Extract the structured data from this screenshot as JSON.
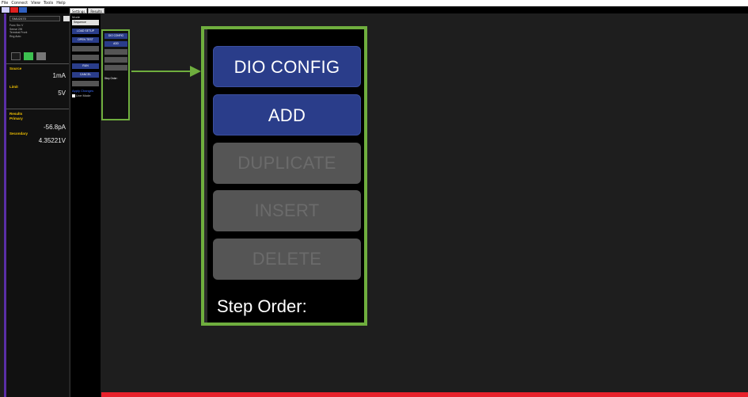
{
  "menu": [
    "File",
    "Connect",
    "View",
    "Tools",
    "Help"
  ],
  "tabs": [
    {
      "label": "Settings",
      "active": true
    },
    {
      "label": "Results",
      "active": false
    }
  ],
  "channel": {
    "name": "SMU2470",
    "info": [
      "Func      Src V",
      "Sense      2W",
      "Terminal   Front",
      "Rng        Auto"
    ],
    "source_label": "Source",
    "source_value": "1mA",
    "limit_label": "Limit",
    "limit_value": "5V",
    "results_label": "Results",
    "primary_label": "Primary",
    "primary_value": "-56.8pA",
    "secondary_label": "Secondary",
    "secondary_value": "4.35221V"
  },
  "mode_column": {
    "label": "Mode",
    "select_value": "Sequence",
    "buttons": [
      {
        "label": "LOAD SETUP",
        "state": "active"
      },
      {
        "label": "OPEN TEST",
        "state": "active"
      },
      {
        "label": "",
        "state": "disabled"
      },
      {
        "label": "",
        "state": "disabled"
      },
      {
        "label": "RUN",
        "state": "active"
      },
      {
        "label": "CANCEL",
        "state": "active"
      },
      {
        "label": "",
        "state": "disabled"
      }
    ],
    "apply_label": "Apply Changes",
    "checkbox_label": "Live Mode"
  },
  "small_config": {
    "buttons": [
      {
        "label": "DIO CONFIG",
        "state": "active"
      },
      {
        "label": "ADD",
        "state": "active"
      },
      {
        "label": "DUPLICATE",
        "state": "disabled"
      },
      {
        "label": "INSERT",
        "state": "disabled"
      },
      {
        "label": "DELETE",
        "state": "disabled"
      }
    ],
    "step_order": "Step Order:"
  },
  "zoom_panel": {
    "buttons": [
      {
        "label": "DIO CONFIG",
        "state": "active"
      },
      {
        "label": "ADD",
        "state": "active"
      },
      {
        "label": "DUPLICATE",
        "state": "disabled"
      },
      {
        "label": "INSERT",
        "state": "disabled"
      },
      {
        "label": "DELETE",
        "state": "disabled"
      }
    ],
    "step_order": "Step Order:"
  },
  "colors": {
    "highlight": "#6fae3e",
    "active_button": "#2a3d8a",
    "disabled_button": "#555555",
    "status_bar": "#e8222c",
    "channel_accent": "#5a2ea6"
  }
}
